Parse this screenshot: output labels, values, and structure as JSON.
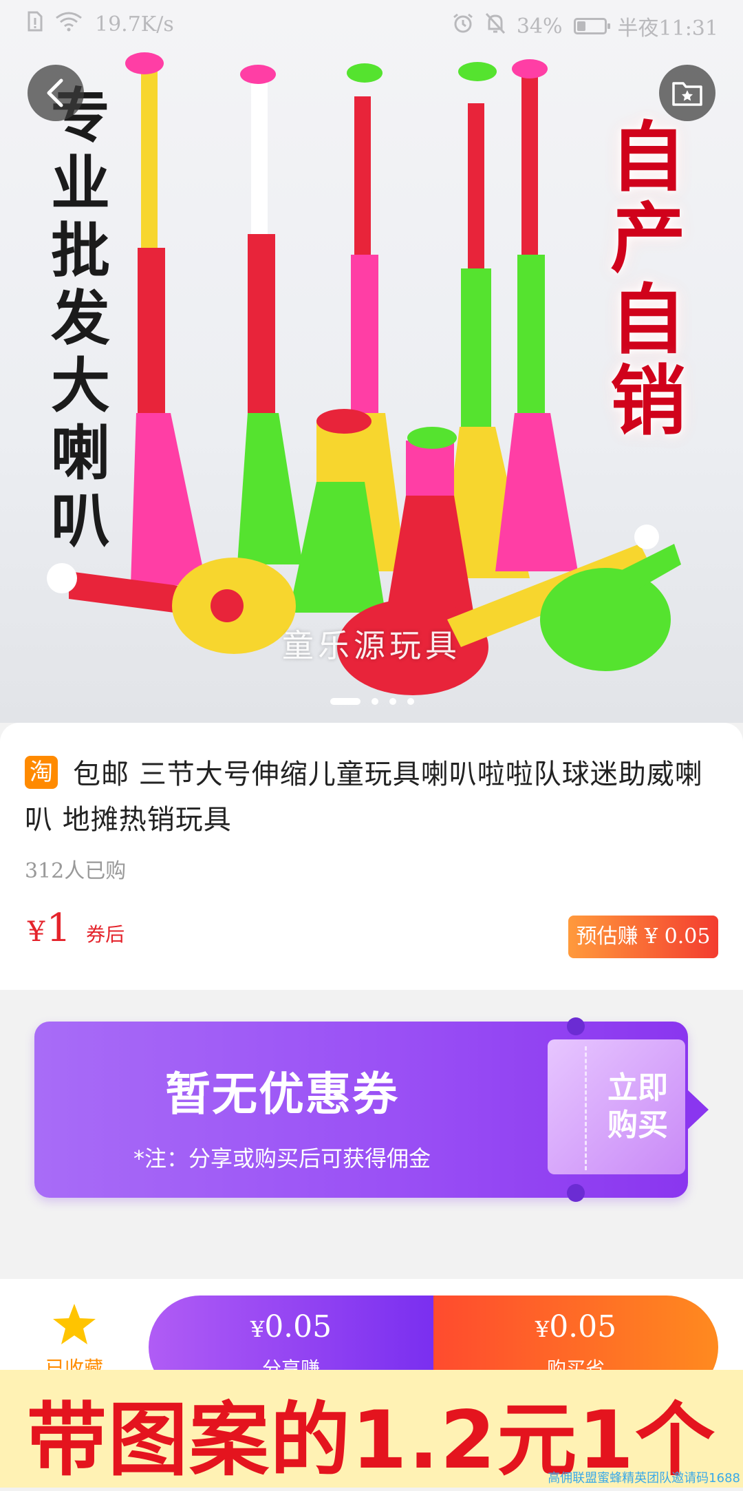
{
  "status_bar": {
    "speed": "19.7K/s",
    "battery": "34%",
    "battery_level": 0.34,
    "time": "半夜11:31"
  },
  "hero": {
    "overlay_left": "专业批发大喇叭",
    "overlay_right": "自产自销",
    "watermark": "童乐源玩具",
    "slide_index": 1,
    "slide_count": 4
  },
  "product": {
    "platform_badge": "淘",
    "title": "包邮 三节大号伸缩儿童玩具喇叭啦啦队球迷助威喇叭 地摊热销玩具",
    "sold": "312人已购",
    "price_currency": "¥",
    "price": "1",
    "price_note": "券后",
    "earn": "预估赚 ¥ 0.05"
  },
  "coupon": {
    "title": "暂无优惠券",
    "note": "*注：分享或购买后可获得佣金",
    "buy_label": "立即购买"
  },
  "action_bar": {
    "favorite_label": "已收藏",
    "share_currency": "¥",
    "share_value": "0.05",
    "share_label": "分享赚",
    "buy_currency": "¥",
    "buy_value": "0.05",
    "buy_label": "购买省"
  },
  "banner": {
    "text": "带图案的1.2元1个",
    "watermark": "高佣联盟蜜蜂精英团队邀请码1688"
  },
  "colors": {
    "price_red": "#e4232b",
    "coupon_purple": "#9a50f5",
    "banner_bg": "#fff2b4",
    "banner_text": "#e4141e"
  }
}
